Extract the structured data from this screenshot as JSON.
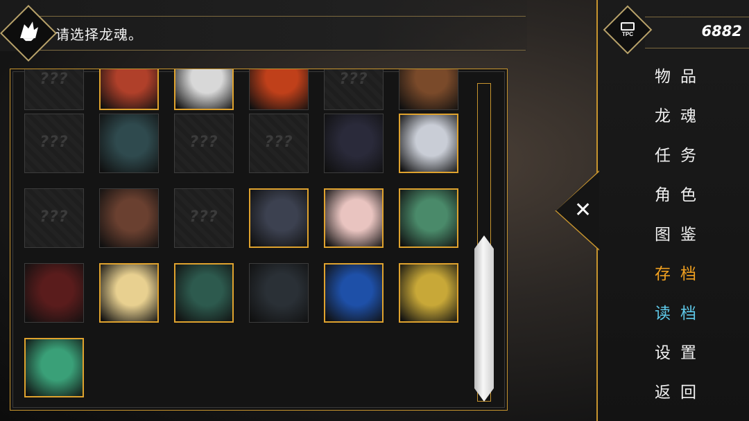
{
  "header": {
    "prompt": "请选择龙魂。"
  },
  "money": {
    "value": "6882",
    "icon": "tpc-currency-icon"
  },
  "menu": {
    "items": [
      {
        "label": "物品",
        "key": "items"
      },
      {
        "label": "龙魂",
        "key": "dragon-soul"
      },
      {
        "label": "任务",
        "key": "quests"
      },
      {
        "label": "角色",
        "key": "characters"
      },
      {
        "label": "图鉴",
        "key": "codex"
      },
      {
        "label": "存档",
        "key": "save"
      },
      {
        "label": "读档",
        "key": "load"
      },
      {
        "label": "设置",
        "key": "settings"
      },
      {
        "label": "返回",
        "key": "back"
      }
    ],
    "close_icon": "close-icon"
  },
  "grid": {
    "locked_label": "???",
    "rows": [
      [
        {
          "state": "locked"
        },
        {
          "state": "owned",
          "color": "#b0402a"
        },
        {
          "state": "owned",
          "color": "#d8d8d8"
        },
        {
          "state": "seen",
          "color": "#c0401a"
        },
        {
          "state": "locked"
        },
        {
          "state": "seen",
          "color": "#7a4a2a"
        }
      ],
      [
        {
          "state": "locked"
        },
        {
          "state": "seen",
          "color": "#2f4a4e"
        },
        {
          "state": "locked"
        },
        {
          "state": "locked"
        },
        {
          "state": "seen",
          "color": "#2a2a3a"
        },
        {
          "state": "owned",
          "color": "#c9cdd6"
        }
      ],
      [
        {
          "state": "locked"
        },
        {
          "state": "seen",
          "color": "#6a4030"
        },
        {
          "state": "locked"
        },
        {
          "state": "owned",
          "color": "#3c4150"
        },
        {
          "state": "owned",
          "color": "#e9c4c0"
        },
        {
          "state": "owned",
          "color": "#4a8a6a"
        }
      ],
      [
        {
          "state": "seen",
          "color": "#5a1c1c"
        },
        {
          "state": "owned",
          "color": "#e8d090"
        },
        {
          "state": "owned",
          "color": "#2d5a4e"
        },
        {
          "state": "seen",
          "color": "#2a3036"
        },
        {
          "state": "owned",
          "color": "#1e50a8"
        },
        {
          "state": "owned",
          "color": "#c8a838"
        }
      ],
      [
        {
          "state": "owned",
          "color": "#3aa078"
        }
      ]
    ]
  },
  "colors": {
    "accent_gold": "#c8952e",
    "save_orange": "#f0a020",
    "load_cyan": "#5ec8e8"
  }
}
